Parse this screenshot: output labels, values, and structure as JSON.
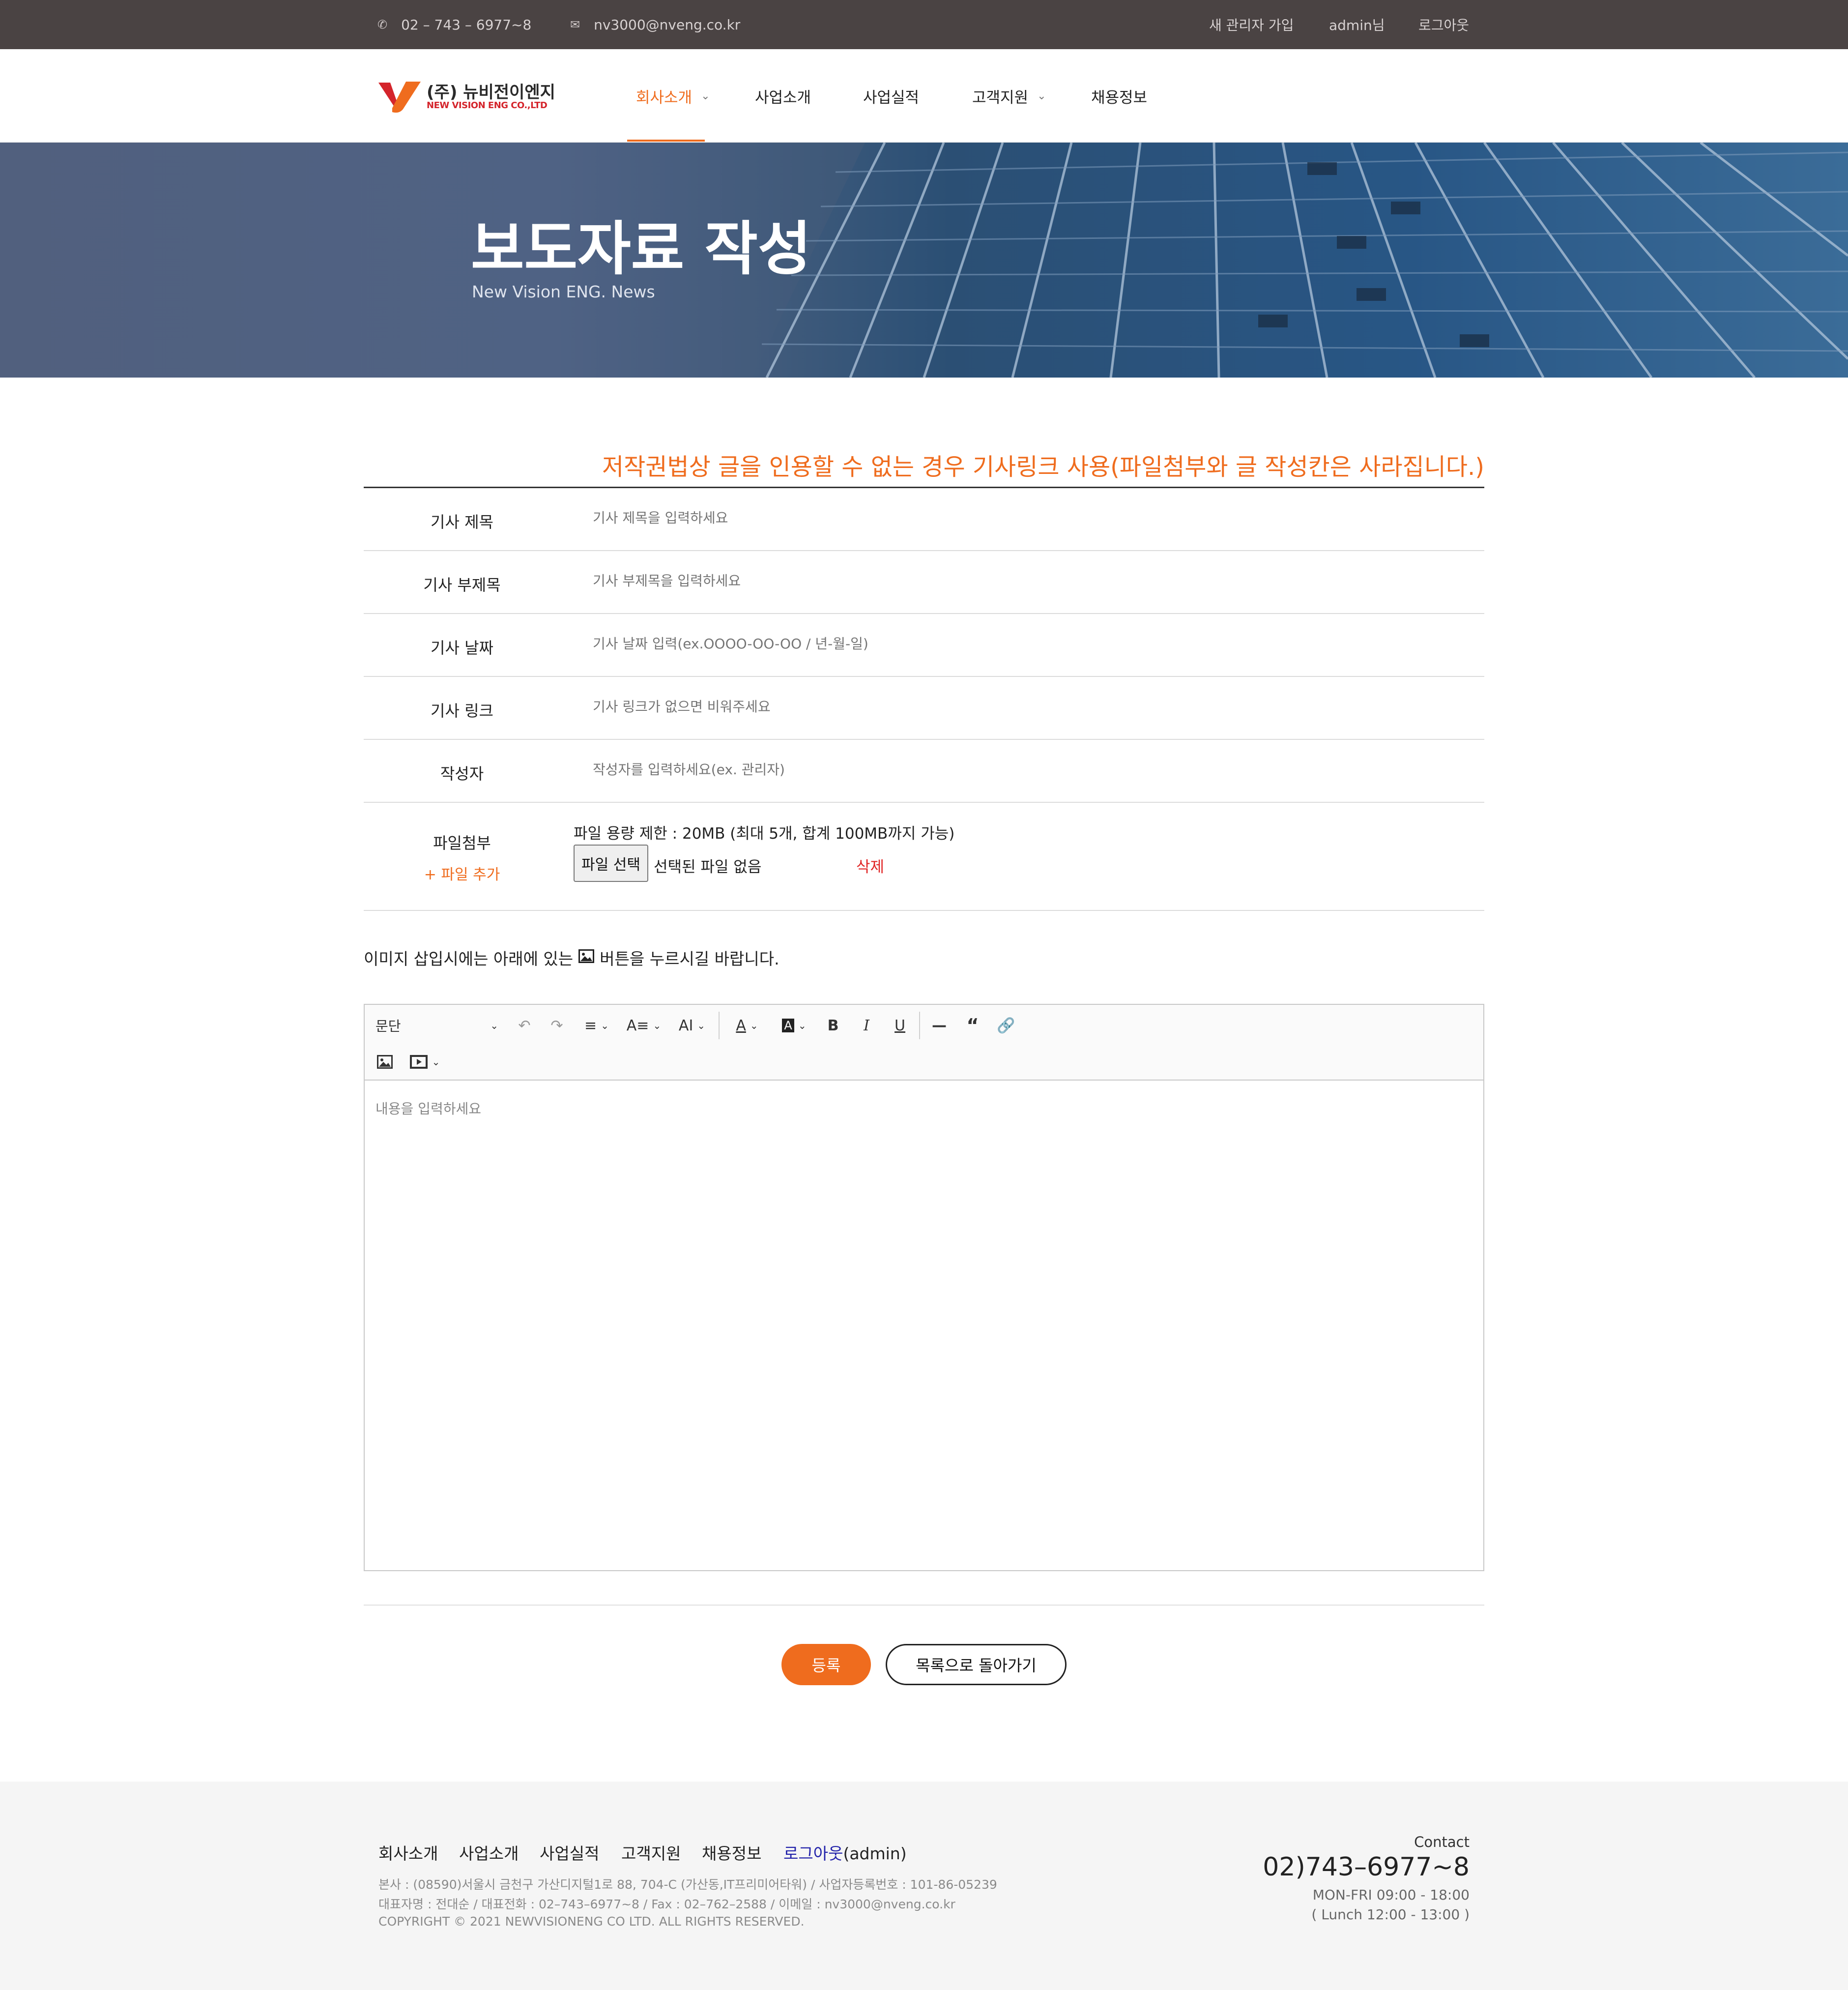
{
  "topbar": {
    "phone": "02 – 743 – 6977~8",
    "email": "nv3000@nveng.co.kr",
    "new_admin": "새 관리자 가입",
    "user": "admin님",
    "logout": "로그아웃"
  },
  "header": {
    "logo_ko": "(주) 뉴비전이엔지",
    "logo_en": "NEW VISION ENG CO.,LTD",
    "nav": [
      "회사소개",
      "사업소개",
      "사업실적",
      "고객지원",
      "채용정보"
    ]
  },
  "banner": {
    "title": "보도자료 작성",
    "subtitle": "New Vision ENG. News"
  },
  "form": {
    "notice": "저작권법상 글을 인용할 수 없는 경우 기사링크 사용(파일첨부와 글 작성칸은 사라집니다.)",
    "fields": [
      {
        "label": "기사 제목",
        "placeholder": "기사 제목을 입력하세요"
      },
      {
        "label": "기사 부제목",
        "placeholder": "기사 부제목을 입력하세요"
      },
      {
        "label": "기사 날짜",
        "placeholder": "기사 날짜 입력(ex.OOOO-OO-OO / 년-월-일)"
      },
      {
        "label": "기사 링크",
        "placeholder": "기사 링크가 없으면 비워주세요"
      },
      {
        "label": "작성자",
        "placeholder": "작성자를 입력하세요(ex. 관리자)"
      }
    ],
    "attachment": {
      "label": "파일첨부",
      "add": "+ 파일 추가",
      "limit": "파일 용량 제한 : 20MB (최대 5개, 합계 100MB까지 가능)",
      "choose": "파일 선택",
      "none": "선택된 파일 없음",
      "delete": "삭제"
    },
    "image_hint_before": "이미지 삽입시에는 아래에 있는",
    "image_hint_after": "버튼을 누르시길 바랍니다."
  },
  "editor": {
    "paragraph": "문단",
    "placeholder": "내용을 입력하세요",
    "icons": [
      "undo-icon",
      "redo-icon",
      "align-icon",
      "font-size-icon",
      "font-family-icon",
      "font-color-icon",
      "background-color-icon",
      "bold-icon",
      "italic-icon",
      "underline-icon",
      "horizontal-line-icon",
      "blockquote-icon",
      "link-icon",
      "image-icon",
      "media-icon"
    ]
  },
  "actions": {
    "submit": "등록",
    "back": "목록으로 돌아가기"
  },
  "footer": {
    "nav": [
      "회사소개",
      "사업소개",
      "사업실적",
      "고객지원",
      "채용정보"
    ],
    "logout": "로그아웃",
    "admin": "(admin)",
    "address": "본사 : (08590)서울시 금천구 가산디지털1로 88, 704-C (가산동,IT프리미어타워) / 사업자등록번호 : 101-86-05239",
    "ceo": "대표자명 : 전대순 / 대표전화 : 02–743–6977~8 / Fax : 02–762–2588 / 이메일 : nv3000@nveng.co.kr",
    "copyright": "COPYRIGHT © 2021 NEWVISIONENG CO LTD. ALL RIGHTS RESERVED.",
    "contact_label": "Contact",
    "contact_phone": "02)743–6977~8",
    "hours": "MON-FRI 09:00 - 18:00",
    "lunch": "( Lunch 12:00 - 13:00 )"
  },
  "colors": {
    "accent": "#ef6c1e",
    "topbar": "#4a4343",
    "delete": "#e02424"
  }
}
